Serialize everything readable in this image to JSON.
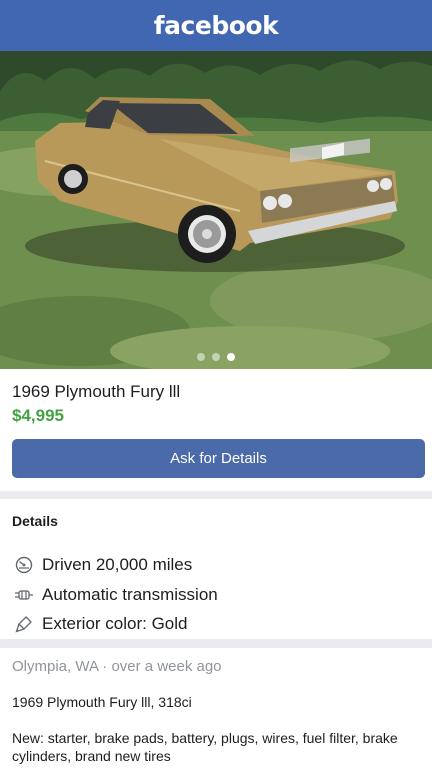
{
  "header": {
    "logo": "facebook",
    "color": "#4267b2"
  },
  "photo": {
    "page_dots": 3,
    "active_dot": 3,
    "car_color": "#b8995a"
  },
  "listing": {
    "title": "1969 Plymouth Fury lll",
    "price": "$4,995",
    "price_color": "#42a244"
  },
  "actions": {
    "ask_label": "Ask for Details"
  },
  "details": {
    "heading": "Details",
    "items": [
      {
        "icon": "speedometer-icon",
        "text": "Driven 20,000 miles"
      },
      {
        "icon": "transmission-icon",
        "text": "Automatic transmission"
      },
      {
        "icon": "paintbrush-icon",
        "text": "Exterior color: Gold"
      }
    ]
  },
  "meta": {
    "location_time": "Olympia, WA · over a week ago"
  },
  "description": {
    "line1": "1969 Plymouth Fury lll, 318ci",
    "line2": "New: starter, brake pads, battery, plugs, wires, fuel filter, brake cylinders, brand new tires"
  }
}
